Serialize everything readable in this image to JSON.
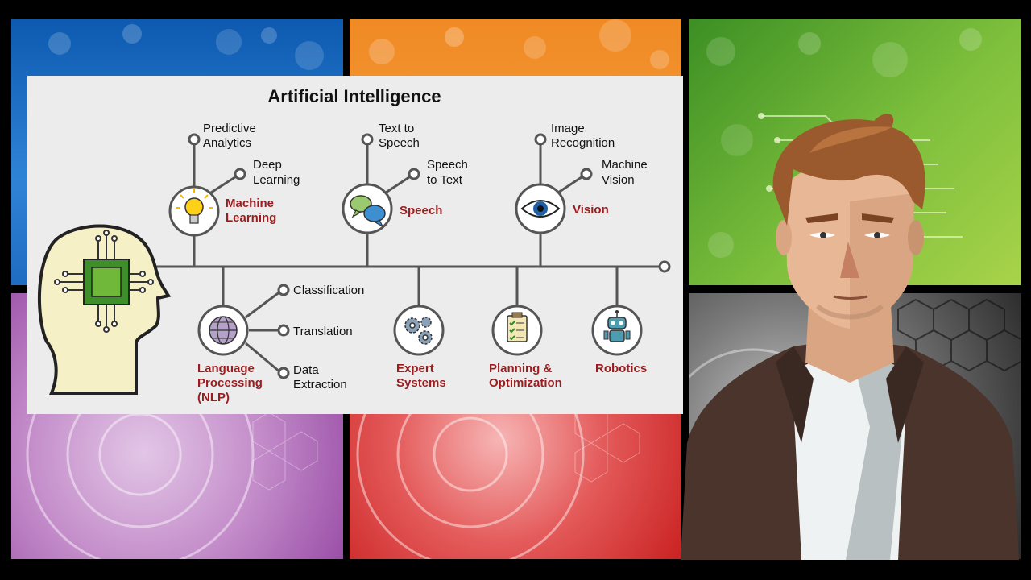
{
  "title": "Artificial Intelligence",
  "branches": {
    "machine_learning": {
      "label_line1": "Machine",
      "label_line2": "Learning",
      "subs": [
        {
          "l1": "Predictive",
          "l2": "Analytics"
        },
        {
          "l1": "Deep",
          "l2": "Learning"
        }
      ]
    },
    "speech": {
      "label": "Speech",
      "subs": [
        {
          "l1": "Text to",
          "l2": "Speech"
        },
        {
          "l1": "Speech",
          "l2": "to Text"
        }
      ]
    },
    "vision": {
      "label": "Vision",
      "subs": [
        {
          "l1": "Image",
          "l2": "Recognition"
        },
        {
          "l1": "Machine",
          "l2": "Vision"
        }
      ]
    },
    "nlp": {
      "label_line1": "Language",
      "label_line2": "Processing",
      "label_line3": "(NLP)",
      "subs": [
        "Classification",
        "Translation"
      ],
      "sub3_l1": "Data",
      "sub3_l2": "Extraction"
    },
    "expert": {
      "label_line1": "Expert",
      "label_line2": "Systems"
    },
    "planning": {
      "label_line1": "Planning &",
      "label_line2": "Optimization"
    },
    "robotics": {
      "label": "Robotics"
    }
  },
  "colors": {
    "category_text": "#9a1c1f",
    "line": "#555555",
    "panel": "#ececec"
  },
  "icons": [
    "brain-chip-icon",
    "lightbulb-icon",
    "speech-bubbles-icon",
    "eye-icon",
    "globe-icon",
    "gears-icon",
    "clipboard-checklist-icon",
    "robot-icon"
  ]
}
